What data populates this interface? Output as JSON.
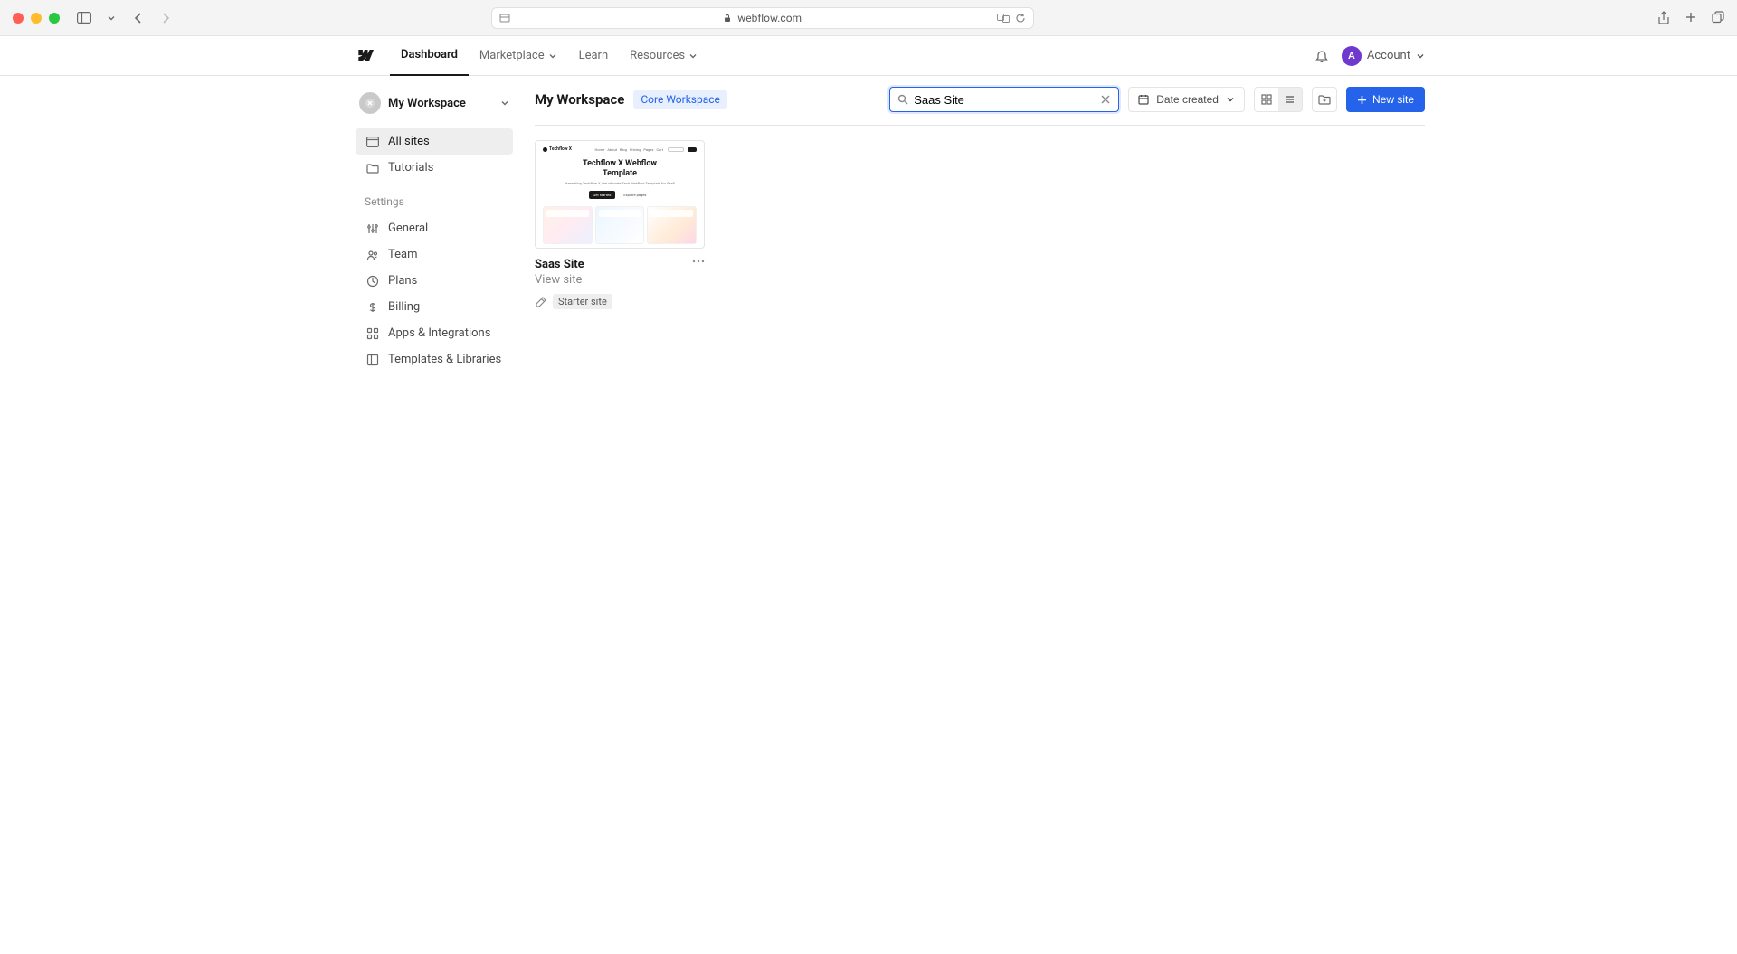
{
  "browser": {
    "url": "webflow.com"
  },
  "header": {
    "nav": {
      "dashboard": "Dashboard",
      "marketplace": "Marketplace",
      "learn": "Learn",
      "resources": "Resources"
    },
    "account_label": "Account",
    "avatar_letter": "A"
  },
  "sidebar": {
    "workspace_name": "My Workspace",
    "items": {
      "all_sites": "All sites",
      "tutorials": "Tutorials"
    },
    "settings_label": "Settings",
    "settings": {
      "general": "General",
      "team": "Team",
      "plans": "Plans",
      "billing": "Billing",
      "apps": "Apps & Integrations",
      "templates": "Templates & Libraries"
    }
  },
  "content": {
    "title": "My Workspace",
    "badge": "Core Workspace",
    "search_value": "Saas Site",
    "sort_label": "Date created",
    "new_site_label": "New site"
  },
  "site": {
    "name": "Saas Site",
    "view_link": "View site",
    "plan_badge": "Starter site",
    "thumb": {
      "brand": "Techflow X",
      "title_line1": "Techflow X Webflow",
      "title_line2": "Template"
    }
  }
}
